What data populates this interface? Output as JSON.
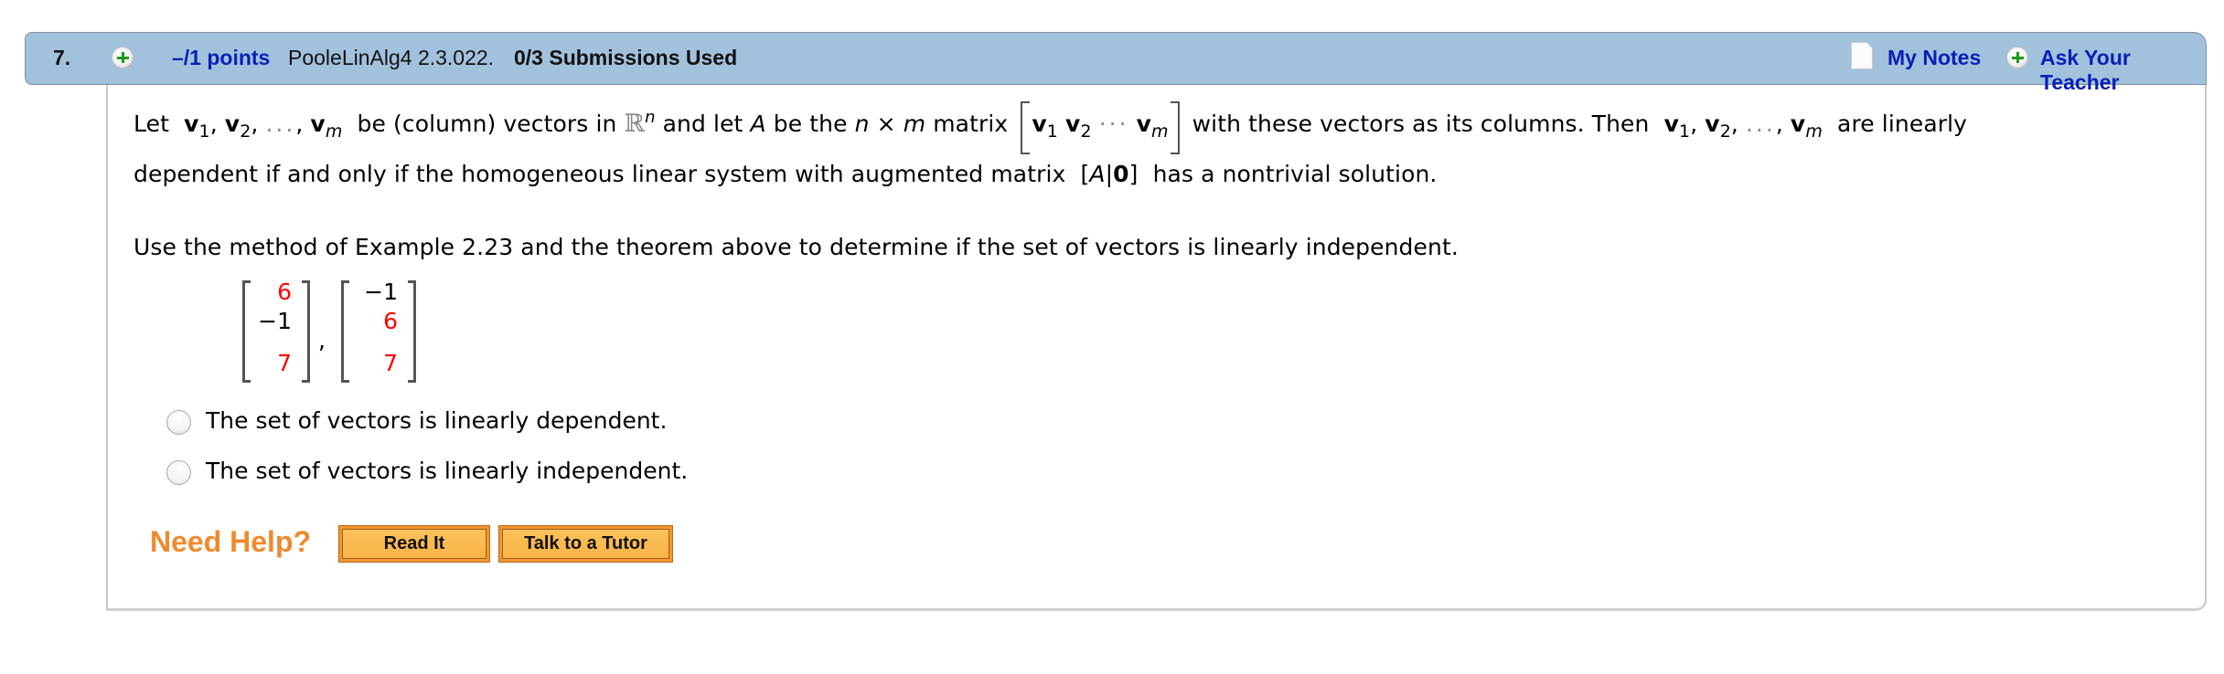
{
  "header": {
    "question_number": "7.",
    "points": "–/1 points",
    "question_id": "PooleLinAlg4 2.3.022.",
    "submissions": "0/3 Submissions Used",
    "my_notes": "My Notes",
    "ask_teacher": "Ask Your Teacher"
  },
  "theorem": {
    "let": "Let",
    "v": "v",
    "sub1": "1",
    "sub2": "2",
    "subm": "m",
    "comma": ",",
    "dots": "...",
    "be_vectors_in": "be (column) vectors in",
    "R": "ℝ",
    "n": "n",
    "and_let": "and let",
    "A": "A",
    "be_the": "be the",
    "n_times_m": "n × m",
    "matrix": "matrix",
    "cdots": "···",
    "with_columns": "with these vectors as its columns. Then",
    "are_linearly": "are linearly",
    "line2": "dependent if and only if the homogeneous linear system with augmented matrix",
    "aug_open": "[",
    "aug_bar": "|",
    "aug_zero": "0",
    "aug_close": "]",
    "line2_end": "has a nontrivial solution."
  },
  "instruction": "Use the method of Example 2.23 and the theorem above to determine if the set of vectors is linearly independent.",
  "vectors": [
    {
      "entries": [
        "6",
        "−1",
        "7"
      ],
      "highlight": [
        true,
        false,
        true
      ]
    },
    {
      "entries": [
        "−1",
        "6",
        "7"
      ],
      "highlight": [
        false,
        true,
        true
      ]
    }
  ],
  "vector_separator": ",",
  "options": [
    {
      "label": "The set of vectors is linearly dependent.",
      "selected": false
    },
    {
      "label": "The set of vectors is linearly independent.",
      "selected": false
    }
  ],
  "help": {
    "label": "Need Help?",
    "read_it": "Read It",
    "tutor": "Talk to a Tutor"
  },
  "colors": {
    "header_bg": "#a2c1dd",
    "link": "#0a1fb6",
    "highlight_red": "#ff0000",
    "help_orange": "#ee8a2e"
  }
}
